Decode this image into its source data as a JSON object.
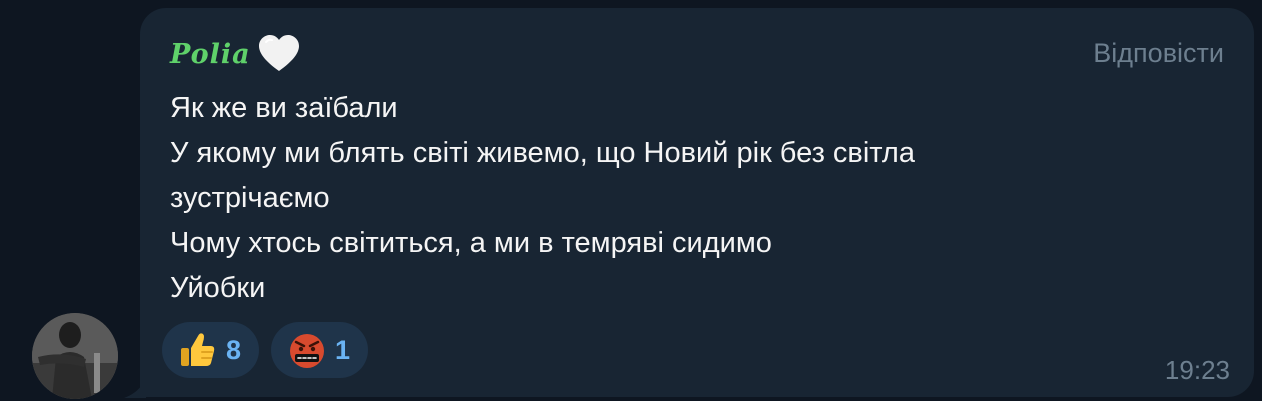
{
  "message": {
    "sender_name": "Polia",
    "sender_icon": "white-heart-icon",
    "reply_label": "Відповісти",
    "lines": [
      "Як же ви заїбали",
      "У якому ми блять світі живемо, що Новий рік без світла",
      "зустрічаємо",
      "Чому хтось світиться, а ми в темряві сидимо",
      "Уйобки"
    ],
    "reactions": [
      {
        "emoji": "thumbs-up-icon",
        "count": "8"
      },
      {
        "emoji": "cursing-face-icon",
        "count": "1"
      }
    ],
    "time": "19:23"
  },
  "colors": {
    "background": "#0e1621",
    "bubble": "#182533",
    "sender_name": "#5fd16a",
    "reaction_count": "#6ab3f3",
    "meta_text": "#6d7f8f"
  }
}
